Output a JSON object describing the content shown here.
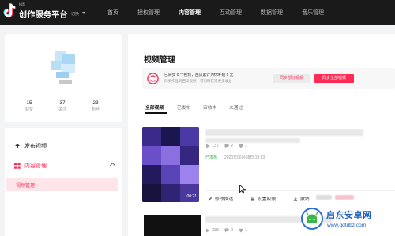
{
  "topbar": {
    "brand_small": "抖音",
    "brand": "创作服务平台",
    "account_label": "切换",
    "nav": [
      "首页",
      "授权管理",
      "内容管理",
      "互动管理",
      "数据管理",
      "音乐管理"
    ],
    "active_nav": "内容管理"
  },
  "profile": {
    "stats": [
      {
        "value": "15",
        "label": "获赞"
      },
      {
        "value": "37",
        "label": "关注"
      },
      {
        "value": "23",
        "label": "粉丝"
      }
    ]
  },
  "sidebar": {
    "items": [
      {
        "label": "发布视频",
        "icon": "upload-icon"
      },
      {
        "label": "内容管理",
        "icon": "grid-icon"
      }
    ],
    "subitems": [
      {
        "label": "视频管理"
      }
    ]
  },
  "main": {
    "title": "视频管理",
    "sync": {
      "line1": "已同步 0 个视频，西瓜累计为你补贴 0 元",
      "line2": "同步作品到西瓜视频，可同时获得更多收益",
      "btn_part": "同步部分视频",
      "btn_all": "同步全部视频"
    },
    "tabs": [
      "全部视频",
      "已发布",
      "审核中",
      "未通过"
    ],
    "videos": [
      {
        "duration": "00:21",
        "plays": "137",
        "comments": "2",
        "likes": "1",
        "status": "已发布",
        "date": "2020年06月08日 19:33"
      },
      {
        "plays": "335",
        "comments": "0",
        "likes": "1"
      }
    ],
    "actions": [
      "修改描述",
      "设置权限",
      "撤销"
    ]
  },
  "watermark": {
    "title": "启东安卓网",
    "url": "www.qdtdbz.com"
  },
  "colors": {
    "accent": "#fe2c55",
    "published": "#3ab54a",
    "topbar": "#1a1a1a"
  }
}
